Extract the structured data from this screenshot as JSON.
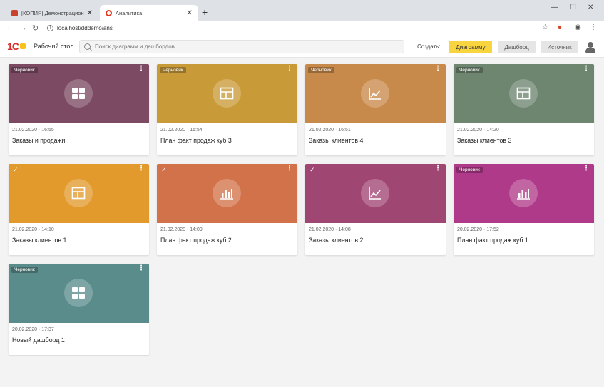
{
  "browser": {
    "tabs": [
      {
        "title": "[КОПИЯ] Демонстрационная б..."
      },
      {
        "title": "Аналитика"
      }
    ],
    "url": "localhost/dddemo/ans"
  },
  "app": {
    "desk_label": "Рабочий стол",
    "search_placeholder": "Поиск диаграмм и дашбордов",
    "create_label": "Создать:",
    "buttons": {
      "chart": "Диаграмму",
      "dashboard": "Дашборд",
      "source": "Источник"
    }
  },
  "cards": [
    {
      "badge": "Черновик",
      "date": "21.02.2020 · 16:55",
      "name": "Заказы и продажи",
      "color": "#7d4a63",
      "icon": "dashboard-icon"
    },
    {
      "badge": "Черновик",
      "date": "21.02.2020 · 16:54",
      "name": "План факт продаж куб 3",
      "color": "#c99a38",
      "icon": "table-icon"
    },
    {
      "badge": "Черновик",
      "date": "21.02.2020 · 16:51",
      "name": "Заказы клиентов 4",
      "color": "#c88a4a",
      "icon": "line-chart-icon"
    },
    {
      "badge": "Черновик",
      "date": "21.02.2020 · 14:20",
      "name": "Заказы клиентов 3",
      "color": "#6e8570",
      "icon": "table-icon"
    },
    {
      "badge": "",
      "date": "21.02.2020 · 14:10",
      "name": "Заказы клиентов 1",
      "color": "#e29a2c",
      "icon": "table-icon"
    },
    {
      "badge": "",
      "date": "21.02.2020 · 14:09",
      "name": "План факт продаж куб 2",
      "color": "#d2724a",
      "icon": "bar-chart-icon"
    },
    {
      "badge": "",
      "date": "21.02.2020 · 14:08",
      "name": "Заказы клиентов 2",
      "color": "#a04672",
      "icon": "line-chart-icon"
    },
    {
      "badge": "Черновик",
      "date": "20.02.2020 · 17:52",
      "name": "План факт продаж куб 1",
      "color": "#b03a8a",
      "icon": "bar-chart-icon"
    },
    {
      "badge": "Черновик",
      "date": "20.02.2020 · 17:37",
      "name": "Новый дашборд 1",
      "color": "#5a8c8c",
      "icon": "dashboard-icon"
    }
  ]
}
